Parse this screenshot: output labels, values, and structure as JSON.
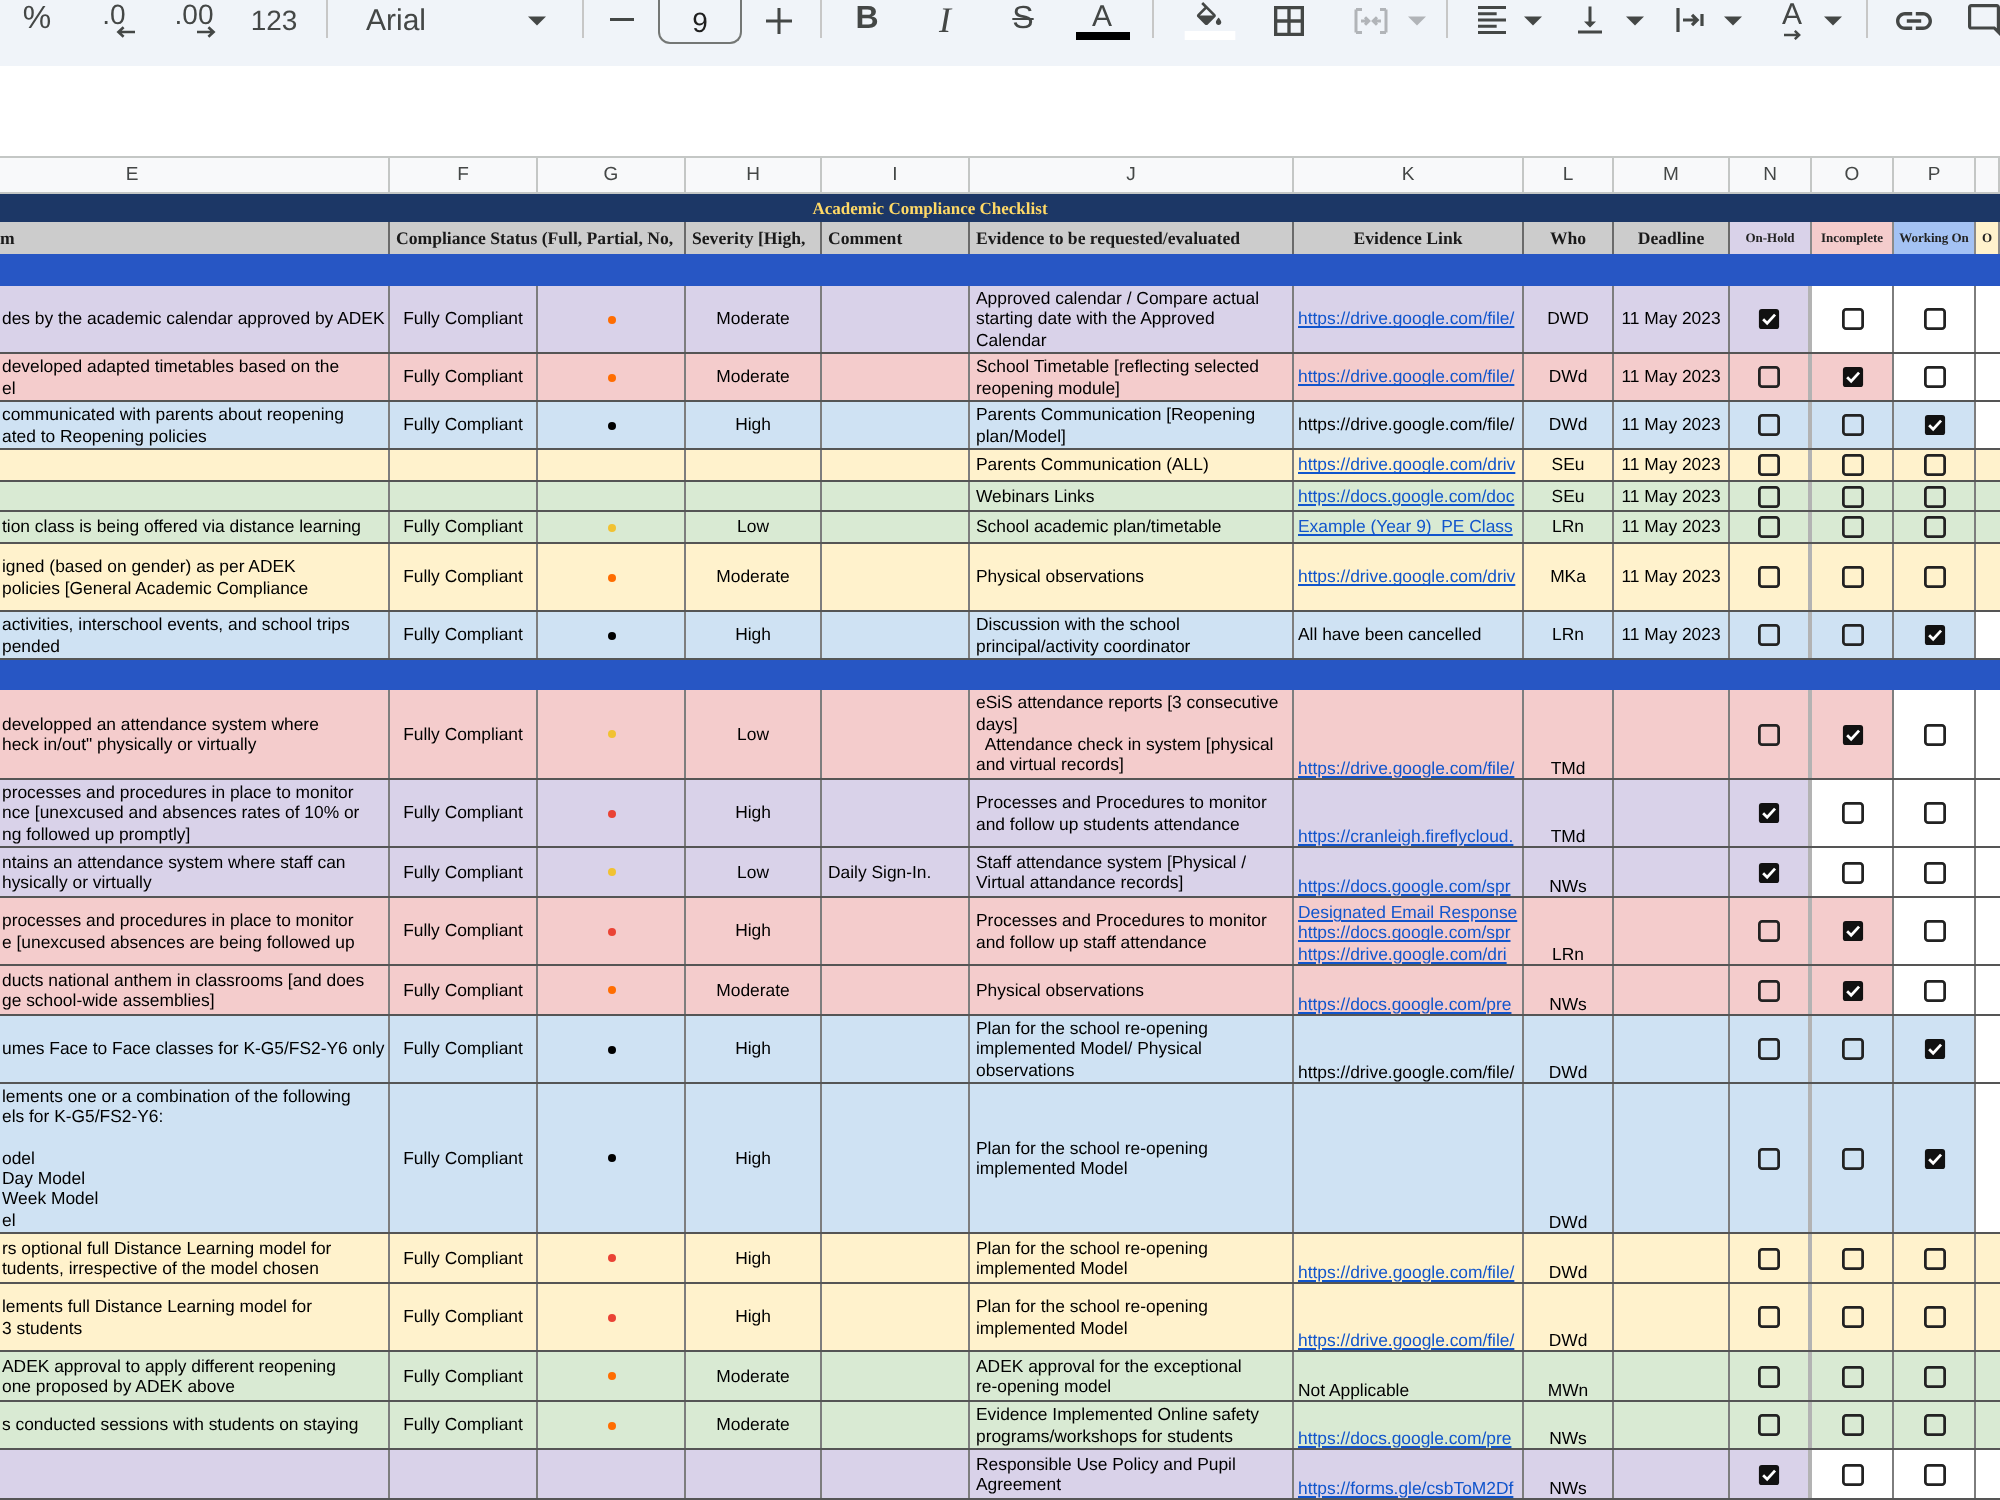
{
  "toolbar": {
    "groups": [
      [
        {
          "kind": "percent",
          "label": "%",
          "disabled": false
        },
        {
          "kind": "fewer",
          "label": ".0",
          "disabled": false
        },
        {
          "kind": "more",
          "label": ".00",
          "disabled": false
        },
        {
          "kind": "numbers",
          "label": "123",
          "disabled": false
        }
      ],
      [
        {
          "kind": "font",
          "label": "Arial",
          "disabled": false
        }
      ],
      [
        {
          "kind": "shrink",
          "disabled": false
        },
        {
          "kind": "size",
          "value": "9",
          "disabled": false
        },
        {
          "kind": "grow",
          "disabled": false
        }
      ],
      [
        {
          "kind": "bold",
          "label": "B",
          "disabled": false
        },
        {
          "kind": "italic",
          "label": "I",
          "disabled": false
        },
        {
          "kind": "strike",
          "label": "S",
          "disabled": false
        },
        {
          "kind": "textcolor",
          "label": "A",
          "disabled": false
        }
      ],
      [
        {
          "kind": "fill",
          "disabled": false
        },
        {
          "kind": "borders",
          "disabled": false
        },
        {
          "kind": "merge",
          "disabled": true
        }
      ],
      [
        {
          "kind": "align",
          "disabled": false
        },
        {
          "kind": "valign",
          "disabled": false
        },
        {
          "kind": "wrap",
          "disabled": false
        },
        {
          "kind": "rotate",
          "label": "A",
          "disabled": false
        }
      ],
      [
        {
          "kind": "link",
          "disabled": false
        },
        {
          "kind": "comment",
          "disabled": false
        }
      ]
    ]
  },
  "sheet": {
    "columns": [
      "E",
      "F",
      "G",
      "H",
      "I",
      "J",
      "K",
      "L",
      "M",
      "N",
      "O",
      "P"
    ],
    "title": "Academic Compliance Checklist",
    "headers": [
      "m",
      "Compliance Status (Full, Partial, No,",
      "Severity [High,",
      "Comment",
      "Evidence to be requested/evaluated",
      "Evidence Link",
      "Who",
      "Deadline"
    ],
    "status_headers": [
      {
        "label": "On-Hold",
        "color": "#d9d2e9"
      },
      {
        "label": "Incomplete",
        "color": "#f4cccc"
      },
      {
        "label": "Working On",
        "color": "#a4c2f4"
      },
      {
        "label": "O",
        "color": "#fff2cc"
      }
    ],
    "sections": [
      {
        "rows": [
          {
            "color": "#d9d2e9",
            "item": "des by the academic calendar approved by ADEK",
            "status": "Fully Compliant",
            "dot": {
              "color": "#ff6d01"
            },
            "severity": "Moderate",
            "evidence": "Approved calendar / Compare actual\nstarting date with the Approved\nCalendar",
            "links": [
              {
                "kind": "link",
                "text": "https://drive.google.com/file/"
              }
            ],
            "who": "DWD",
            "deadline": "11 May 2023",
            "checks": [
              {
                "checked": true
              },
              {
                "checked": false
              },
              {
                "checked": false
              }
            ]
          },
          {
            "color": "#f4cccc",
            "item": "developed adapted timetables based on the\nel",
            "status": "Fully Compliant",
            "dot": {
              "color": "#ff6d01"
            },
            "severity": "Moderate",
            "evidence": "School Timetable [reflecting selected\nreopening module]",
            "links": [
              {
                "kind": "link",
                "text": "https://drive.google.com/file/"
              }
            ],
            "who": "DWd",
            "deadline": "11 May 2023",
            "checks": [
              {
                "checked": false
              },
              {
                "checked": true
              },
              {
                "checked": false
              }
            ]
          },
          {
            "color": "#cfe2f3",
            "item": "communicated with parents about reopening\nated to Reopening policies",
            "status": "Fully Compliant",
            "dot": {
              "color": "#000000"
            },
            "severity": "High",
            "evidence": "Parents Communication [Reopening\nplan/Model]",
            "links": [
              {
                "kind": "text",
                "text": "https://drive.google.com/file/"
              }
            ],
            "who": "DWd",
            "deadline": "11 May 2023",
            "checks": [
              {
                "checked": false
              },
              {
                "checked": false
              },
              {
                "checked": true
              }
            ]
          },
          {
            "color": "#fff2cc",
            "evidence": "Parents Communication (ALL)",
            "links": [
              {
                "kind": "link",
                "text": "https://drive.google.com/driv"
              }
            ],
            "who": "SEu",
            "deadline": "11 May 2023",
            "checks": [
              {
                "checked": false
              },
              {
                "checked": false
              },
              {
                "checked": false
              }
            ]
          },
          {
            "color": "#d9ead3",
            "evidence": "Webinars Links",
            "links": [
              {
                "kind": "link",
                "text": "https://docs.google.com/doc"
              }
            ],
            "who": "SEu",
            "deadline": "11 May 2023",
            "checks": [
              {
                "checked": false
              },
              {
                "checked": false
              },
              {
                "checked": false
              }
            ]
          },
          {
            "color": "#d9ead3",
            "item": "tion class is being offered via distance learning",
            "status": "Fully Compliant",
            "dot": {
              "color": "#f1c232"
            },
            "severity": "Low",
            "evidence": "School academic plan/timetable",
            "links": [
              {
                "kind": "link",
                "text": "Example (Year 9)  PE Class"
              }
            ],
            "who": "LRn",
            "deadline": "11 May 2023",
            "checks": [
              {
                "checked": false
              },
              {
                "checked": false
              },
              {
                "checked": false
              }
            ]
          },
          {
            "color": "#fff2cc",
            "item": "igned (based on gender) as per ADEK\npolicies [General Academic Compliance",
            "status": "Fully Compliant",
            "dot": {
              "color": "#ff6d01"
            },
            "severity": "Moderate",
            "evidence": "Physical observations",
            "links": [
              {
                "kind": "link",
                "text": "https://drive.google.com/driv"
              }
            ],
            "who": "MKa",
            "deadline": "11 May 2023",
            "checks": [
              {
                "checked": false
              },
              {
                "checked": false
              },
              {
                "checked": false
              }
            ]
          },
          {
            "color": "#cfe2f3",
            "item": "activities, interschool events, and school trips\npended",
            "status": "Fully Compliant",
            "dot": {
              "color": "#000000"
            },
            "severity": "High",
            "evidence": "Discussion with the school\nprincipal/activity coordinator",
            "links": [
              {
                "kind": "text",
                "text": "All have been cancelled"
              }
            ],
            "who": "LRn",
            "deadline": "11 May 2023",
            "checks": [
              {
                "checked": false
              },
              {
                "checked": false
              },
              {
                "checked": true
              }
            ]
          }
        ]
      },
      {
        "rows": [
          {
            "color": "#f4cccc",
            "item": "developped an attendance system where\nheck in/out\" physically or virtually",
            "status": "Fully Compliant",
            "dot": {
              "color": "#f1c232"
            },
            "severity": "Low",
            "evidence": "eSiS attendance reports [3 consecutive\ndays]\n  Attendance check in system [physical\nand virtual records]",
            "links": [
              {
                "kind": "link",
                "text": "https://drive.google.com/file/"
              }
            ],
            "who": "TMd",
            "checks": [
              {
                "checked": false
              },
              {
                "checked": true
              },
              {
                "checked": false
              }
            ]
          },
          {
            "color": "#d9d2e9",
            "item": "processes and procedures in place to monitor\nnce [unexcused and absences rates of 10% or\nng followed up promptly]",
            "status": "Fully Compliant",
            "dot": {
              "color": "#ea4335"
            },
            "severity": "High",
            "evidence": "Processes and Procedures to monitor\nand follow up students attendance",
            "links": [
              {
                "kind": "link",
                "text": "https://cranleigh.fireflycloud."
              }
            ],
            "who": "TMd",
            "checks": [
              {
                "checked": true
              },
              {
                "checked": false
              },
              {
                "checked": false
              }
            ]
          },
          {
            "color": "#d9d2e9",
            "item": "ntains an attendance system where staff can\nhysically or virtually",
            "status": "Fully Compliant",
            "dot": {
              "color": "#f1c232"
            },
            "severity": "Low",
            "comment": "Daily Sign-In.",
            "evidence": "Staff attendance system [Physical /\nVirtual attandance records]",
            "links": [
              {
                "kind": "link",
                "text": "https://docs.google.com/spr"
              }
            ],
            "who": "NWs",
            "checks": [
              {
                "checked": true
              },
              {
                "checked": false
              },
              {
                "checked": false
              }
            ]
          },
          {
            "color": "#f4cccc",
            "item": "processes and procedures in place to monitor\ne [unexcused absences are being followed up",
            "status": "Fully Compliant",
            "dot": {
              "color": "#ea4335"
            },
            "severity": "High",
            "evidence": "Processes and Procedures to monitor\nand follow up staff attendance",
            "links": [
              {
                "kind": "link",
                "text": "Designated Email Response"
              },
              {
                "kind": "link",
                "text": "https://docs.google.com/spr"
              },
              {
                "kind": "link",
                "text": "https://drive.google.com/dri"
              }
            ],
            "who": "LRn",
            "checks": [
              {
                "checked": false
              },
              {
                "checked": true
              },
              {
                "checked": false
              }
            ]
          },
          {
            "color": "#f4cccc",
            "item": "ducts national anthem in classrooms [and does\nge school-wide assemblies]",
            "status": "Fully Compliant",
            "dot": {
              "color": "#ff6d01"
            },
            "severity": "Moderate",
            "evidence": "Physical observations",
            "links": [
              {
                "kind": "link",
                "text": "https://docs.google.com/pre"
              }
            ],
            "who": "NWs",
            "checks": [
              {
                "checked": false
              },
              {
                "checked": true
              },
              {
                "checked": false
              }
            ]
          },
          {
            "color": "#cfe2f3",
            "item": "umes Face to Face classes for K-G5/FS2-Y6 only",
            "status": "Fully Compliant",
            "dot": {
              "color": "#000000"
            },
            "severity": "High",
            "evidence": "Plan for the school re-opening\nimplemented Model/ Physical\nobservations",
            "links": [
              {
                "kind": "text",
                "text": "https://drive.google.com/file/"
              }
            ],
            "who": "DWd",
            "checks": [
              {
                "checked": false
              },
              {
                "checked": false
              },
              {
                "checked": true
              }
            ]
          },
          {
            "color": "#cfe2f3",
            "item": "lements one or a combination of the following\nels for K-G5/FS2-Y6:\n\nodel\nDay Model\nWeek Model\nel",
            "status": "Fully Compliant",
            "dot": {
              "color": "#000000"
            },
            "severity": "High",
            "evidence": "Plan for the school re-opening\nimplemented Model",
            "who": "DWd",
            "checks": [
              {
                "checked": false
              },
              {
                "checked": false
              },
              {
                "checked": true
              }
            ]
          },
          {
            "color": "#fff2cc",
            "item": "rs optional full Distance Learning model for\ntudents, irrespective of the model chosen",
            "status": "Fully Compliant",
            "dot": {
              "color": "#ea4335"
            },
            "severity": "High",
            "evidence": "Plan for the school re-opening\nimplemented Model",
            "links": [
              {
                "kind": "link",
                "text": "https://drive.google.com/file/"
              }
            ],
            "who": "DWd",
            "checks": [
              {
                "checked": false
              },
              {
                "checked": false
              },
              {
                "checked": false
              }
            ]
          },
          {
            "color": "#fff2cc",
            "item": "lements full Distance Learning model for\n3 students",
            "status": "Fully Compliant",
            "dot": {
              "color": "#ea4335"
            },
            "severity": "High",
            "evidence": "Plan for the school re-opening\nimplemented Model",
            "links": [
              {
                "kind": "link",
                "text": "https://drive.google.com/file/"
              }
            ],
            "who": "DWd",
            "checks": [
              {
                "checked": false
              },
              {
                "checked": false
              },
              {
                "checked": false
              }
            ]
          },
          {
            "color": "#d9ead3",
            "item": "ADEK approval to apply different reopening\none proposed by ADEK above",
            "status": "Fully Compliant",
            "dot": {
              "color": "#ff6d01"
            },
            "severity": "Moderate",
            "evidence": "ADEK approval for the exceptional\nre-opening model",
            "links": [
              {
                "kind": "text",
                "text": "Not Applicable"
              }
            ],
            "who": "MWn",
            "checks": [
              {
                "checked": false
              },
              {
                "checked": false
              },
              {
                "checked": false
              }
            ]
          },
          {
            "color": "#d9ead3",
            "item": "s conducted sessions with students on staying",
            "status": "Fully Compliant",
            "dot": {
              "color": "#ff6d01"
            },
            "severity": "Moderate",
            "evidence": "Evidence Implemented Online safety\nprograms/workshops for students",
            "links": [
              {
                "kind": "link",
                "text": "https://docs.google.com/pre"
              }
            ],
            "who": "NWs",
            "checks": [
              {
                "checked": false
              },
              {
                "checked": false
              },
              {
                "checked": false
              }
            ]
          },
          {
            "color": "#d9d2e9",
            "evidence": "Responsible Use Policy and Pupil\nAgreement",
            "links": [
              {
                "kind": "link",
                "text": "https://forms.gle/csbToM2Df"
              }
            ],
            "who": "NWs",
            "checks": [
              {
                "checked": true
              },
              {
                "checked": false
              },
              {
                "checked": false
              }
            ]
          }
        ]
      }
    ]
  }
}
